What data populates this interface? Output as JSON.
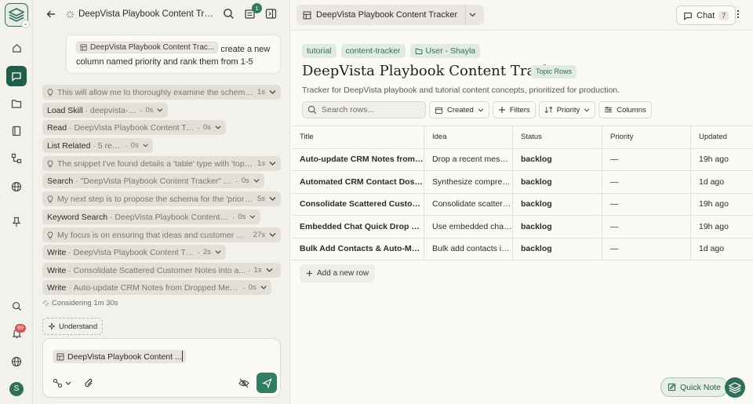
{
  "rail": {
    "items": [
      {
        "name": "home-icon"
      },
      {
        "name": "chat-icon",
        "active": true
      },
      {
        "name": "folder-icon"
      },
      {
        "name": "book-icon"
      },
      {
        "name": "workflow-icon"
      },
      {
        "name": "globe-icon"
      },
      {
        "name": "pin-icon"
      }
    ],
    "bottom": {
      "search": "search-icon",
      "notifications_count": "69",
      "globe": "globe-icon",
      "avatar_initial": "S"
    }
  },
  "chat": {
    "title": "DeepVista Playbook Content Tracker",
    "notification_count": "1",
    "user_message": {
      "chip": "DeepVista Playbook Content Trac...",
      "text": "create a new column named priority and rank them from 1-5"
    },
    "steps": [
      {
        "type": "thought",
        "text": "This will allow me to thoroughly examine the schema ...",
        "dur": "1s"
      },
      {
        "type": "action",
        "label": "Load Skill",
        "text": "deepvista-table",
        "dur": "0s"
      },
      {
        "type": "action",
        "label": "Read",
        "text": "DeepVista Playbook Content Tracker",
        "dur": "0s"
      },
      {
        "type": "action",
        "label": "List Related",
        "text": "5 results",
        "dur": "0s"
      },
      {
        "type": "thought",
        "text": "The snippet I've found details a 'table' type with 'topic' ...",
        "dur": "1s"
      },
      {
        "type": "action",
        "label": "Search",
        "text": "\"DeepVista Playbook Content Tracker\" in table",
        "dur": "0s"
      },
      {
        "type": "thought",
        "text": "My next step is to propose the schema for the 'priority...",
        "dur": "5s"
      },
      {
        "type": "action",
        "label": "Keyword Search",
        "text": "DeepVista Playbook Content Tracker",
        "dur": "0s"
      },
      {
        "type": "thought",
        "text": "My focus is on ensuring that ideas and customer me...",
        "dur": "27s"
      },
      {
        "type": "action",
        "label": "Write",
        "text": "DeepVista Playbook Content Tracker",
        "dur": "2s"
      },
      {
        "type": "action",
        "label": "Write",
        "text": "Consolidate Scattered Customer Notes into a...",
        "dur": "1s"
      },
      {
        "type": "action",
        "label": "Write",
        "text": "Auto-update CRM Notes from Dropped Messages",
        "dur": "0s"
      }
    ],
    "considering": "Considering 1m 30s",
    "understand": "Understand",
    "composer_chip": "DeepVista Playbook Content ..."
  },
  "main": {
    "tab_title": "DeepVista Playbook Content Tracker",
    "chat_button": "Chat",
    "chat_count": "7",
    "tags": [
      "tutorial",
      "content-tracker",
      "User - Shayla"
    ],
    "title": "DeepVista Playbook Content Tracker",
    "badge": "Topic Rows",
    "description": "Tracker for DeepVista playbook and tutorial content concepts, prioritized for production.",
    "search_placeholder": "Search rows...",
    "toolbar": {
      "created": "Created",
      "filters": "Filters",
      "priority": "Priority",
      "columns": "Columns"
    },
    "columns": [
      "Title",
      "Idea",
      "Status",
      "Priority",
      "Updated"
    ],
    "rows": [
      [
        "Auto-update CRM Notes from Dr...",
        "Drop a recent messag...",
        "backlog",
        "—",
        "19h ago"
      ],
      [
        "Automated CRM Contact Dossier...",
        "Synthesize comprehe...",
        "backlog",
        "—",
        "1d ago"
      ],
      [
        "Consolidate Scattered Customer ...",
        "Consolidate scattere...",
        "backlog",
        "—",
        "19h ago"
      ],
      [
        "Embedded Chat Quick Drop & Au...",
        "Use embedded chat t...",
        "backlog",
        "—",
        "19h ago"
      ],
      [
        "Bulk Add Contacts & Auto-Match...",
        "Bulk add contacts int...",
        "backlog",
        "—",
        "1d ago"
      ]
    ],
    "add_row": "Add a new row",
    "quick_note": "Quick Note"
  },
  "colors": {
    "accent": "#2f6e58",
    "accent_light": "#e1ebe3",
    "send": "#2f7d62",
    "notif_red": "#d9534f"
  }
}
